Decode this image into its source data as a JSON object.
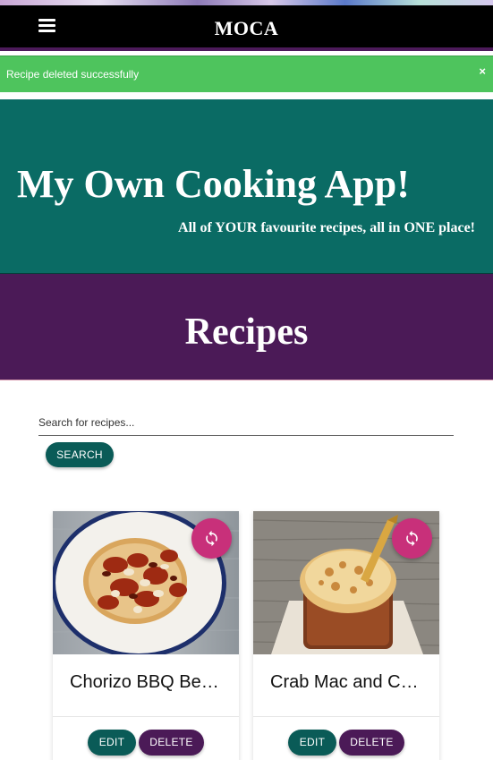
{
  "navbar": {
    "brand": "MOCA",
    "menu_icon": "hamburger-icon"
  },
  "alert": {
    "message": "Recipe deleted successfully",
    "close_label": "×",
    "color": "#4ec45d"
  },
  "hero": {
    "title": "My Own Cooking App!",
    "subtitle": "All of YOUR favourite recipes, all in ONE place!",
    "color": "#0a6b64"
  },
  "section": {
    "title": "Recipes",
    "color": "#4b1a57"
  },
  "search": {
    "placeholder": "Search for recipes...",
    "value": "",
    "button_label": "SEARCH"
  },
  "recipes": [
    {
      "title": "Chorizo BBQ Beans on Toast",
      "edit_label": "EDIT",
      "delete_label": "DELETE",
      "action_icon": "refresh-icon"
    },
    {
      "title": "Crab Mac and Cheese",
      "edit_label": "EDIT",
      "delete_label": "DELETE",
      "action_icon": "refresh-icon"
    }
  ],
  "colors": {
    "accent": "#c8307a",
    "teal_button": "#0a5b57",
    "purple_button": "#4b1a57"
  }
}
